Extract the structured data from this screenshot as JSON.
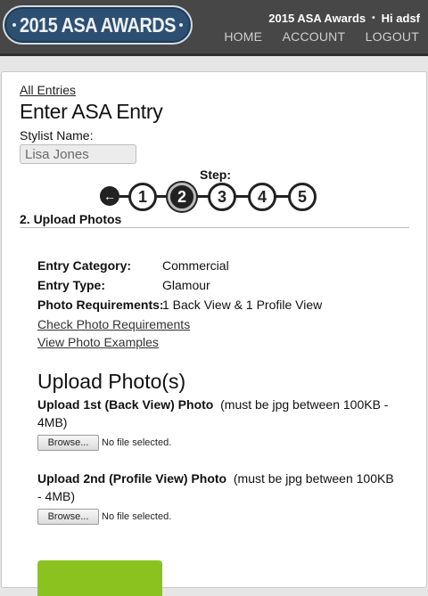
{
  "header": {
    "logo_text": "2015 ASA AWARDS",
    "site_name": "2015 ASA Awards",
    "separator": "•",
    "greeting": "Hi adsf",
    "nav": [
      "HOME",
      "ACCOUNT",
      "LOGOUT"
    ]
  },
  "main": {
    "breadcrumb": "All Entries",
    "title": "Enter ASA Entry",
    "stylist_label": "Stylist Name:",
    "stylist_value": "Lisa Jones",
    "step_label": "Step:",
    "back_icon": "←",
    "steps": [
      "1",
      "2",
      "3",
      "4",
      "5"
    ],
    "active_step": 2,
    "section_title": "2. Upload Photos",
    "details": [
      {
        "label": "Entry Category:",
        "value": "Commercial"
      },
      {
        "label": "Entry Type:",
        "value": "Glamour"
      },
      {
        "label": "Photo Requirements:",
        "value": "1 Back View & 1 Profile View"
      }
    ],
    "links": [
      "Check Photo Requirements",
      "View Photo Examples"
    ],
    "upload_heading": "Upload Photo(s)",
    "uploads": [
      {
        "label": "Upload 1st (Back View) Photo",
        "note": "(must be jpg between 100KB - 4MB)",
        "browse": "Browse...",
        "status": "No file selected."
      },
      {
        "label": "Upload 2nd (Profile View) Photo",
        "note": "(must be jpg between 100KB - 4MB)",
        "browse": "Browse...",
        "status": "No file selected."
      }
    ]
  },
  "colors": {
    "header_bg": "#474747",
    "logo_bg": "#2d4f72",
    "submit_green": "#8cc21f"
  }
}
